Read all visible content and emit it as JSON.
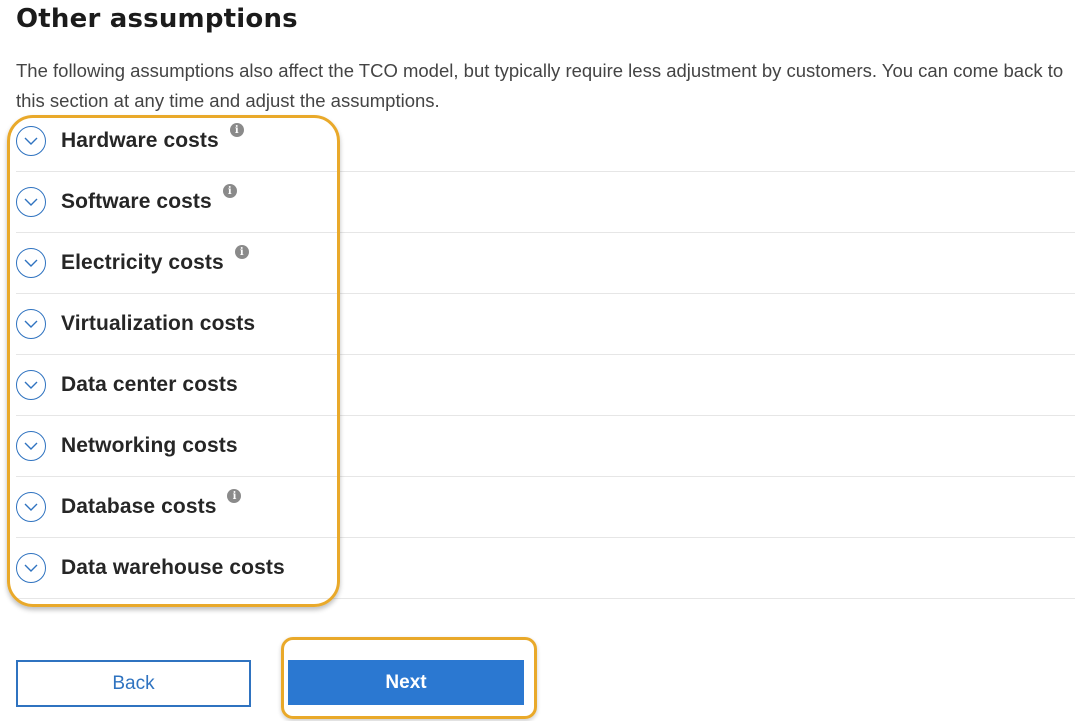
{
  "section": {
    "title": "Other assumptions",
    "description": "The following assumptions also affect the TCO model, but typically require less adjustment by customers. You can come back to this section at any time and adjust the assumptions."
  },
  "accordion": {
    "items": [
      {
        "label": "Hardware costs",
        "has_info": true,
        "icon": "chevron-down-circle-icon"
      },
      {
        "label": "Software costs",
        "has_info": true,
        "icon": "chevron-down-circle-icon"
      },
      {
        "label": "Electricity costs",
        "has_info": true,
        "icon": "chevron-down-circle-icon"
      },
      {
        "label": "Virtualization costs",
        "has_info": false,
        "icon": "chevron-down-circle-icon"
      },
      {
        "label": "Data center costs",
        "has_info": false,
        "icon": "chevron-down-circle-icon"
      },
      {
        "label": "Networking costs",
        "has_info": false,
        "icon": "chevron-down-circle-icon"
      },
      {
        "label": "Database costs",
        "has_info": true,
        "icon": "chevron-down-circle-icon"
      },
      {
        "label": "Data warehouse costs",
        "has_info": false,
        "icon": "chevron-down-circle-icon"
      }
    ],
    "info_glyph": "i"
  },
  "buttons": {
    "back_label": "Back",
    "next_label": "Next"
  },
  "colors": {
    "accent": "#2b78d1",
    "highlight": "#e9a92a"
  }
}
